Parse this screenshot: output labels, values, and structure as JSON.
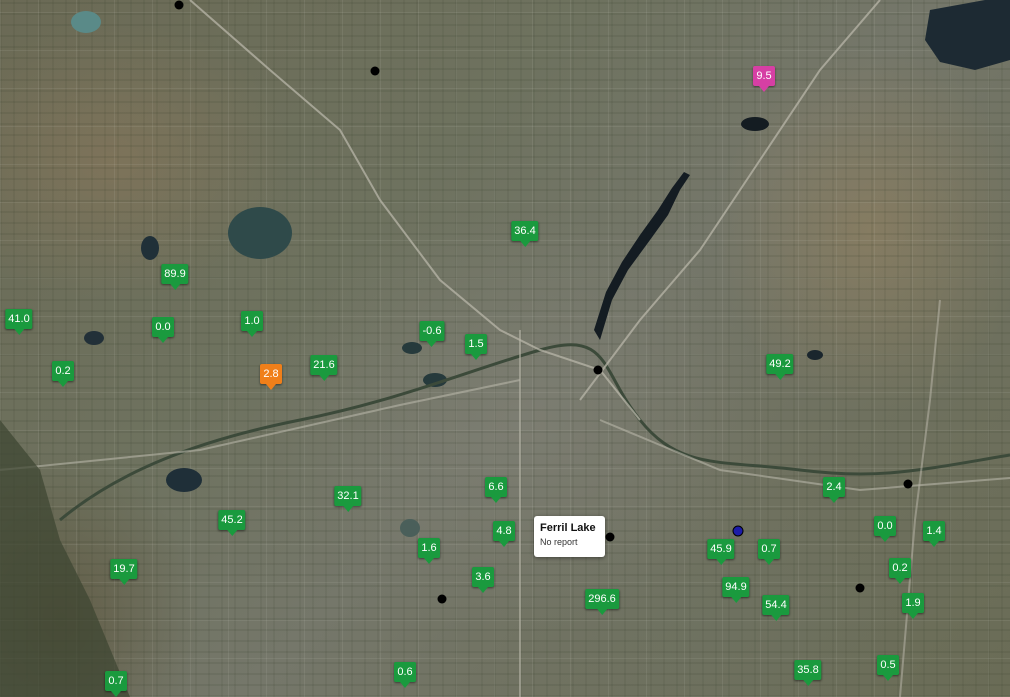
{
  "map": {
    "popup": {
      "title": "Ferril Lake",
      "subtitle": "No report"
    },
    "colors": {
      "green": "#1a9a3e",
      "orange": "#f07f1a",
      "magenta": "#d63fa4",
      "station_dot": "#000000",
      "selected_dot": "#1c1ca8"
    },
    "markers": [
      {
        "value": "9.5",
        "color": "magenta"
      },
      {
        "value": "36.4",
        "color": "green"
      },
      {
        "value": "89.9",
        "color": "green"
      },
      {
        "value": "41.0",
        "color": "green"
      },
      {
        "value": "0.0",
        "color": "green"
      },
      {
        "value": "1.0",
        "color": "green"
      },
      {
        "value": "-0.6",
        "color": "green"
      },
      {
        "value": "1.5",
        "color": "green"
      },
      {
        "value": "0.2",
        "color": "green"
      },
      {
        "value": "2.8",
        "color": "orange"
      },
      {
        "value": "21.6",
        "color": "green"
      },
      {
        "value": "49.2",
        "color": "green"
      },
      {
        "value": "6.6",
        "color": "green"
      },
      {
        "value": "2.4",
        "color": "green"
      },
      {
        "value": "32.1",
        "color": "green"
      },
      {
        "value": "45.2",
        "color": "green"
      },
      {
        "value": "4.8",
        "color": "green"
      },
      {
        "value": "0.0",
        "color": "green"
      },
      {
        "value": "1.4",
        "color": "green"
      },
      {
        "value": "45.9",
        "color": "green"
      },
      {
        "value": "0.7",
        "color": "green"
      },
      {
        "value": "1.6",
        "color": "green"
      },
      {
        "value": "19.7",
        "color": "green"
      },
      {
        "value": "0.2",
        "color": "green"
      },
      {
        "value": "3.6",
        "color": "green"
      },
      {
        "value": "94.9",
        "color": "green"
      },
      {
        "value": "296.6",
        "color": "green"
      },
      {
        "value": "54.4",
        "color": "green"
      },
      {
        "value": "1.9",
        "color": "green"
      },
      {
        "value": "0.6",
        "color": "green"
      },
      {
        "value": "35.8",
        "color": "green"
      },
      {
        "value": "0.5",
        "color": "green"
      },
      {
        "value": "0.7",
        "color": "green"
      }
    ]
  }
}
